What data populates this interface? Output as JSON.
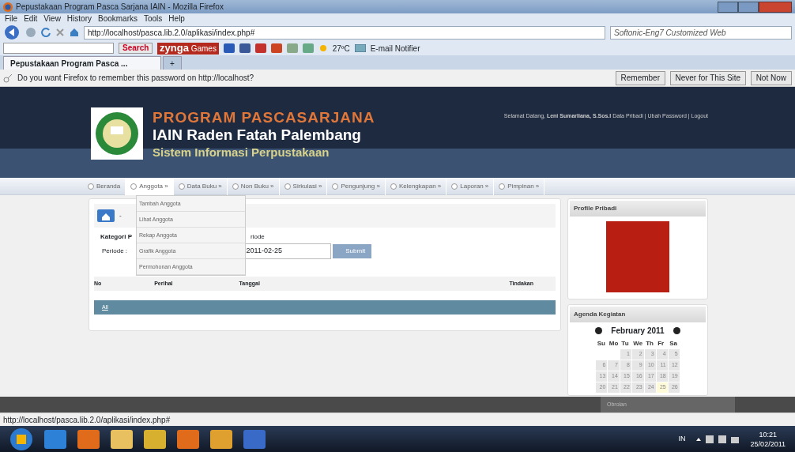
{
  "window": {
    "title": "Pepustakaan Program Pasca Sarjana IAIN - Mozilla Firefox"
  },
  "menu_bar": [
    "File",
    "Edit",
    "View",
    "History",
    "Bookmarks",
    "Tools",
    "Help"
  ],
  "address_bar": {
    "url": "http://localhost/pasca.lib.2.0/aplikasi/index.php#",
    "search_placeholder": "Softonic-Eng7 Customized Web"
  },
  "bookmarks_toolbar": {
    "search_button": "Search",
    "zynga": "zynga",
    "games": "Games",
    "temperature": "27ºC",
    "email_notifier": "E-mail Notifier"
  },
  "tabs": [
    {
      "label": "Pepustakaan Program Pasca ...",
      "selected": true
    },
    {
      "label": "+",
      "selected": false
    }
  ],
  "notification": {
    "message": "Do you want Firefox to remember this password on http://localhost?",
    "buttons": [
      "Remember",
      "Never for This Site",
      "Not Now"
    ]
  },
  "header": {
    "title": "PROGRAM PASCASARJANA",
    "subtitle": "IAIN Raden Fatah Palembang",
    "tagline": "Sistem Informasi Perpustakaan",
    "welcome": "Selamat Datang,",
    "user": "Leni Sumarliana, S.Sos.I",
    "links": [
      "Data Pribadi",
      "Ubah Password",
      "Logout"
    ],
    "separator": "|"
  },
  "nav": [
    {
      "label": "Beranda",
      "selected": false
    },
    {
      "label": "Anggota »",
      "selected": true
    },
    {
      "label": "Data Buku »",
      "selected": false
    },
    {
      "label": "Non Buku »",
      "selected": false
    },
    {
      "label": "Sirkulasi »",
      "selected": false
    },
    {
      "label": "Pengunjung »",
      "selected": false
    },
    {
      "label": "Kelengkapan »",
      "selected": false
    },
    {
      "label": "Laporan »",
      "selected": false
    },
    {
      "label": "Pimpinan »",
      "selected": false
    }
  ],
  "dropdown": [
    "Tambah Anggota",
    "Lihat Anggota",
    "Rekap Anggota",
    "Grafik Anggota",
    "Permohonan Anggota"
  ],
  "content": {
    "crumb": "-",
    "category_label": "Kategori P",
    "category_rest": "riode",
    "period_label": "Periode :",
    "period_to": "2011-02-25",
    "submit": "Submit",
    "columns": [
      "No",
      "Perihal",
      "Tanggal",
      "Tindakan"
    ],
    "footer_link": "All"
  },
  "profile": {
    "title": "Profile Pribadi"
  },
  "agenda": {
    "title": "Agenda Kegiatan",
    "month": "February 2011",
    "weekdays": [
      "Su",
      "Mo",
      "Tu",
      "We",
      "Th",
      "Fr",
      "Sa"
    ],
    "weeks": [
      [
        {
          "day": "1",
          "today": false
        },
        {
          "day": "2",
          "today": false
        },
        {
          "day": "3",
          "today": false
        },
        {
          "day": "4",
          "today": false
        },
        {
          "day": "5",
          "today": false
        }
      ],
      [
        {
          "day": "6",
          "today": false
        },
        {
          "day": "7",
          "today": false
        },
        {
          "day": "8",
          "today": false
        },
        {
          "day": "9",
          "today": false
        },
        {
          "day": "10",
          "today": false
        },
        {
          "day": "11",
          "today": false
        },
        {
          "day": "12",
          "today": false
        }
      ],
      [
        {
          "day": "13",
          "today": false
        },
        {
          "day": "14",
          "today": false
        },
        {
          "day": "15",
          "today": false
        },
        {
          "day": "16",
          "today": false
        },
        {
          "day": "17",
          "today": false
        },
        {
          "day": "18",
          "today": false
        },
        {
          "day": "19",
          "today": false
        }
      ],
      [
        {
          "day": "20",
          "today": false
        },
        {
          "day": "21",
          "today": false
        },
        {
          "day": "22",
          "today": false
        },
        {
          "day": "23",
          "today": false
        },
        {
          "day": "24",
          "today": false
        },
        {
          "day": "25",
          "today": true
        },
        {
          "day": "26",
          "today": false
        }
      ]
    ]
  },
  "chat_bar": {
    "label": "Obrolan"
  },
  "status_bar": {
    "text": "http://localhost/pasca.lib.2.0/aplikasi/index.php#"
  },
  "taskbar": {
    "language": "IN",
    "time": "10:21",
    "date": "25/02/2011"
  }
}
